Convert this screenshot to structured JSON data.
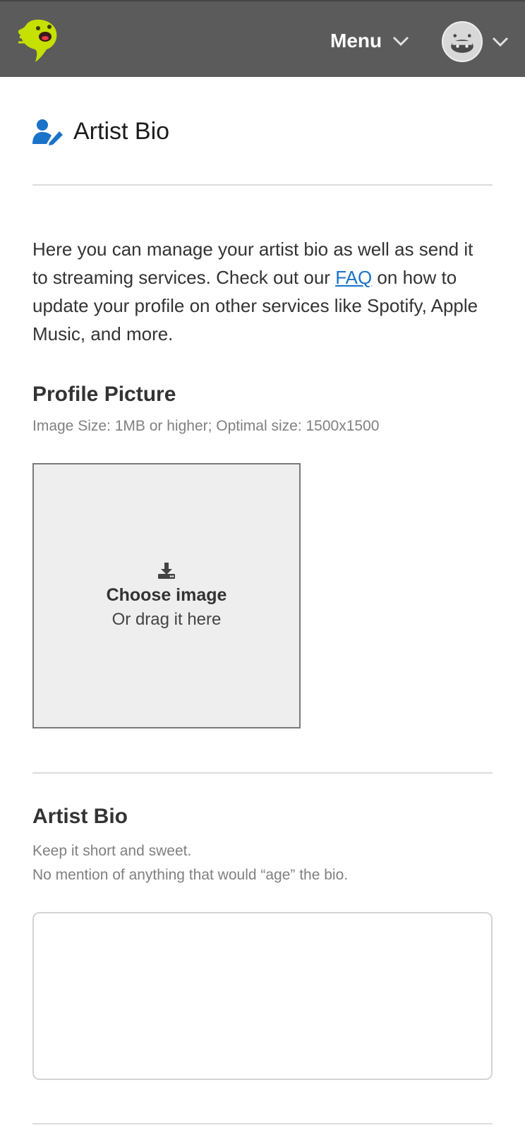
{
  "header": {
    "menu_label": "Menu",
    "logo_icon": "monster-logo-icon",
    "avatar_icon": "avatar-icon",
    "chevron_icon": "chevron-down-icon",
    "colors": {
      "bar": "#5b5b5b",
      "logo": "#c6e000"
    }
  },
  "page": {
    "title": "Artist Bio",
    "title_icon": "user-edit-icon",
    "title_icon_color": "#1a73c9",
    "intro_before_link": "Here you can manage your artist bio  as well as send it to streaming services. Check out our ",
    "intro_link": "FAQ",
    "intro_after_link": " on how to update your profile on other services like Spotify, Apple Music, and more."
  },
  "profile_picture": {
    "title": "Profile Picture",
    "hint": "Image Size: 1MB or higher; Optimal size: 1500x1500",
    "dropzone_icon": "download-icon",
    "choose_label": "Choose image",
    "drag_label": "Or drag it here"
  },
  "artist_bio": {
    "title": "Artist Bio",
    "hint_line1": "Keep it short and sweet.",
    "hint_line2": "No mention of anything that would “age” the bio.",
    "textarea_value": ""
  }
}
